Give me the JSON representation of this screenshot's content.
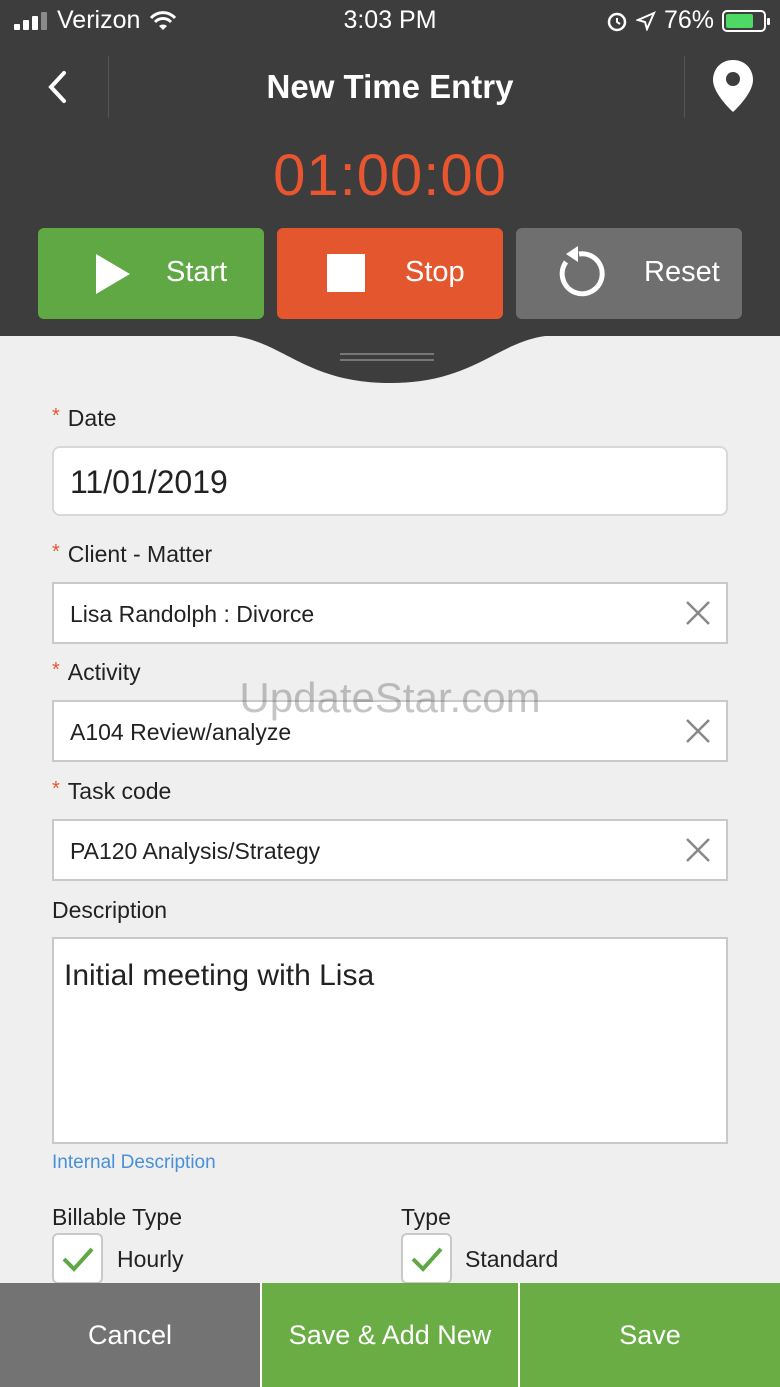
{
  "status_bar": {
    "carrier": "Verizon",
    "time": "3:03 PM",
    "battery": "76%"
  },
  "nav": {
    "title": "New Time Entry"
  },
  "timer": {
    "value": "01:00:00"
  },
  "controls": {
    "start": "Start",
    "stop": "Stop",
    "reset": "Reset"
  },
  "form": {
    "date": {
      "label": "Date",
      "value": "11/01/2019"
    },
    "client_matter": {
      "label": "Client - Matter",
      "value": "Lisa Randolph : Divorce"
    },
    "activity": {
      "label": "Activity",
      "value": "A104 Review/analyze"
    },
    "task_code": {
      "label": "Task code",
      "value": "PA120 Analysis/Strategy"
    },
    "description": {
      "label": "Description",
      "value": "Initial meeting with Lisa"
    },
    "internal_description_link": "Internal Description",
    "billable_type": {
      "label": "Billable Type",
      "option": "Hourly"
    },
    "type": {
      "label": "Type",
      "option": "Standard"
    },
    "required_marker": "*"
  },
  "footer": {
    "cancel": "Cancel",
    "save_add_new": "Save & Add New",
    "save": "Save"
  },
  "watermark": "UpdateStar.com",
  "colors": {
    "header_bg": "#3d3d3d",
    "timer": "#e8552f",
    "start": "#5fa844",
    "stop": "#e4572e",
    "reset": "#6f6f6f",
    "save": "#6aad45",
    "cancel": "#737373",
    "link": "#4a90d9"
  }
}
